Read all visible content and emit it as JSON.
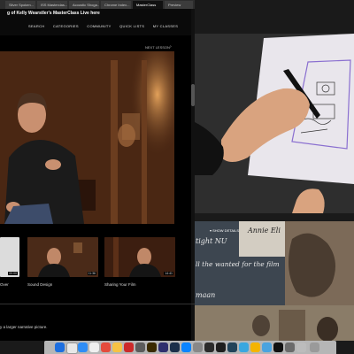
{
  "browser": {
    "tabs": [
      {
        "label": "Silver Spoken..."
      },
      {
        "label": "ISS Masterclas..."
      },
      {
        "label": "Acoustic Shoga..."
      },
      {
        "label": "Chrome Index..."
      },
      {
        "label": "MasterClass"
      },
      {
        "label": "Preview"
      }
    ],
    "banner": "g of Kelly Wearstler's MasterClass Live here",
    "nav": [
      "SEARCH",
      "CATEGORIES",
      "COMMUNITY",
      "QUICK LISTS",
      "MY CLASSES"
    ],
    "next_lesson": "NEXT LESSON",
    "thumbs": [
      {
        "caption": "Over",
        "time": "00:00"
      },
      {
        "caption": "Sound Design",
        "time": "11:36"
      },
      {
        "caption": "Sharing Your Film",
        "time": "14:41"
      }
    ],
    "bottom_text": "y a larger narrative picture."
  },
  "film": {
    "show_details": "SHOW DETAILS",
    "lines": [
      "Annie Eli",
      "tight NU",
      "ll the wanted for the film",
      "maan"
    ]
  },
  "colors": {
    "dock_bg": "#d2d2d2",
    "accent_purple": "#8a6fd0"
  }
}
